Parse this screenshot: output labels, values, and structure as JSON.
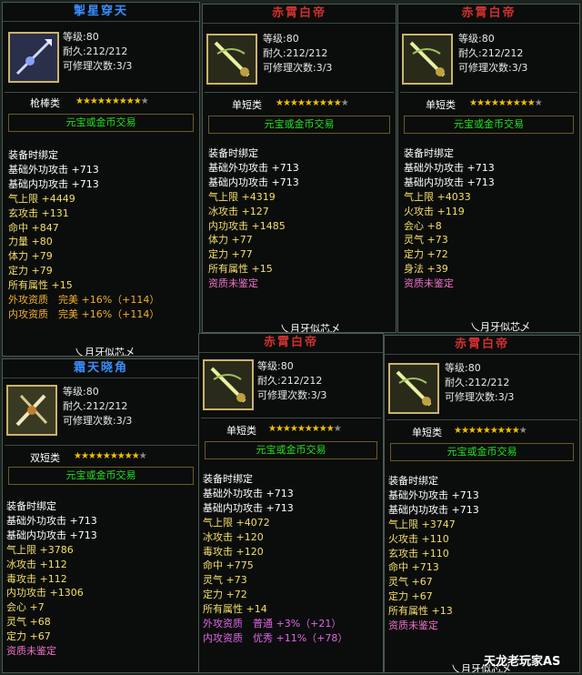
{
  "labels": {
    "level": "等级",
    "durability": "耐久",
    "repairs": "可修理次数",
    "trade": "元宝或金币交易",
    "bound": "装备时绑定",
    "footer": "乀月牙似芯乄"
  },
  "colors": {
    "title_blue": "#3a8eff",
    "title_red": "#d03030",
    "trade_green": "#22e022",
    "star_gold": "#f0c000",
    "attr_yellow": "#f5df6a",
    "attr_purple": "#e066e8"
  },
  "items": [
    {
      "title": "掣星穿天",
      "icon": "spear-weapon-icon",
      "level": ":80",
      "durability": ":212/212",
      "repairs": ":3/3",
      "category": "枪棒类",
      "stars": "★★★★★★★★★",
      "stars_off": "★",
      "attrs": [
        {
          "t": "基础外功攻击 +713",
          "c": "a-white"
        },
        {
          "t": "基础内功攻击 +713",
          "c": "a-white"
        },
        {
          "t": "气上限 +4449",
          "c": "a-yellow"
        },
        {
          "t": "玄攻击 +131",
          "c": "a-yellow"
        },
        {
          "t": "命中 +847",
          "c": "a-yellow"
        },
        {
          "t": "力量 +80",
          "c": "a-yellow"
        },
        {
          "t": "体力 +79",
          "c": "a-yellow"
        },
        {
          "t": "定力 +79",
          "c": "a-yellow"
        },
        {
          "t": "所有属性 +15",
          "c": "a-yellow"
        },
        {
          "t": "外攻资质　完美 +16%（+114）",
          "c": "a-orange"
        },
        {
          "t": "内攻资质　完美 +16%（+114）",
          "c": "a-orange"
        }
      ],
      "footer": "乀月牙似芯乄"
    },
    {
      "title": "赤霄白帝",
      "icon": "sword-weapon-icon",
      "level": ":80",
      "durability": ":212/212",
      "repairs": ":3/3",
      "category": "单短类",
      "stars": "★★★★★★★★★",
      "stars_off": "★",
      "attrs": [
        {
          "t": "基础外功攻击 +713",
          "c": "a-white"
        },
        {
          "t": "基础内功攻击 +713",
          "c": "a-white"
        },
        {
          "t": "气上限 +4319",
          "c": "a-yellow"
        },
        {
          "t": "冰攻击 +127",
          "c": "a-yellow"
        },
        {
          "t": "内功攻击 +1485",
          "c": "a-yellow"
        },
        {
          "t": "体力 +77",
          "c": "a-yellow"
        },
        {
          "t": "定力 +77",
          "c": "a-yellow"
        },
        {
          "t": "所有属性 +15",
          "c": "a-yellow"
        },
        {
          "t": "资质未鉴定",
          "c": "a-pink"
        }
      ],
      "footer": "乀月牙似芯乄"
    },
    {
      "title": "赤霄白帝",
      "icon": "sword-weapon-icon",
      "level": ":80",
      "durability": ":212/212",
      "repairs": ":3/3",
      "category": "单短类",
      "stars": "★★★★★★★★★",
      "stars_off": "★",
      "attrs": [
        {
          "t": "基础外功攻击 +713",
          "c": "a-white"
        },
        {
          "t": "基础内功攻击 +713",
          "c": "a-white"
        },
        {
          "t": "气上限 +4033",
          "c": "a-yellow"
        },
        {
          "t": "火攻击 +119",
          "c": "a-yellow"
        },
        {
          "t": "会心 +8",
          "c": "a-yellow"
        },
        {
          "t": "灵气 +73",
          "c": "a-yellow"
        },
        {
          "t": "定力 +72",
          "c": "a-yellow"
        },
        {
          "t": "身法 +39",
          "c": "a-yellow"
        },
        {
          "t": "资质未鉴定",
          "c": "a-pink"
        }
      ],
      "footer": "乀月牙似芯乄"
    },
    {
      "title": "霜天晓角",
      "icon": "dual-blade-weapon-icon",
      "level": ":80",
      "durability": ":212/212",
      "repairs": ":3/3",
      "category": "双短类",
      "stars": "★★★★★★★★★",
      "stars_off": "★",
      "attrs": [
        {
          "t": "基础外功攻击 +713",
          "c": "a-white"
        },
        {
          "t": "基础内功攻击 +713",
          "c": "a-white"
        },
        {
          "t": "气上限 +3786",
          "c": "a-yellow"
        },
        {
          "t": "冰攻击 +112",
          "c": "a-yellow"
        },
        {
          "t": "毒攻击 +112",
          "c": "a-yellow"
        },
        {
          "t": "内功攻击 +1306",
          "c": "a-yellow"
        },
        {
          "t": "会心 +7",
          "c": "a-yellow"
        },
        {
          "t": "灵气 +68",
          "c": "a-yellow"
        },
        {
          "t": "定力 +67",
          "c": "a-yellow"
        },
        {
          "t": "资质未鉴定",
          "c": "a-pink"
        }
      ],
      "footer": ""
    },
    {
      "title": "赤霄白帝",
      "icon": "sword-weapon-icon",
      "level": ":80",
      "durability": ":212/212",
      "repairs": ":3/3",
      "category": "单短类",
      "stars": "★★★★★★★★★",
      "stars_off": "★",
      "attrs": [
        {
          "t": "基础外功攻击 +713",
          "c": "a-white"
        },
        {
          "t": "基础内功攻击 +713",
          "c": "a-white"
        },
        {
          "t": "气上限 +4072",
          "c": "a-yellow"
        },
        {
          "t": "冰攻击 +120",
          "c": "a-yellow"
        },
        {
          "t": "毒攻击 +120",
          "c": "a-yellow"
        },
        {
          "t": "命中 +775",
          "c": "a-yellow"
        },
        {
          "t": "灵气 +73",
          "c": "a-yellow"
        },
        {
          "t": "定力 +72",
          "c": "a-yellow"
        },
        {
          "t": "所有属性 +14",
          "c": "a-yellow"
        },
        {
          "t": "外攻资质　普通 +3%（+21）",
          "c": "a-purple"
        },
        {
          "t": "内攻资质　优秀 +11%（+78）",
          "c": "a-purple"
        }
      ],
      "footer": ""
    },
    {
      "title": "赤霄白帝",
      "icon": "sword-weapon-icon",
      "level": ":80",
      "durability": ":212/212",
      "repairs": ":3/3",
      "category": "单短类",
      "stars": "★★★★★★★★★",
      "stars_off": "★",
      "attrs": [
        {
          "t": "基础外功攻击 +713",
          "c": "a-white"
        },
        {
          "t": "基础内功攻击 +713",
          "c": "a-white"
        },
        {
          "t": "气上限 +3747",
          "c": "a-yellow"
        },
        {
          "t": "火攻击 +110",
          "c": "a-yellow"
        },
        {
          "t": "玄攻击 +110",
          "c": "a-yellow"
        },
        {
          "t": "命中 +713",
          "c": "a-yellow"
        },
        {
          "t": "灵气 +67",
          "c": "a-yellow"
        },
        {
          "t": "定力 +67",
          "c": "a-yellow"
        },
        {
          "t": "所有属性 +13",
          "c": "a-yellow"
        },
        {
          "t": "资质未鉴定",
          "c": "a-pink"
        }
      ],
      "footer": "乀月牙似芯乄"
    }
  ],
  "watermark": "天龙老玩家AS"
}
